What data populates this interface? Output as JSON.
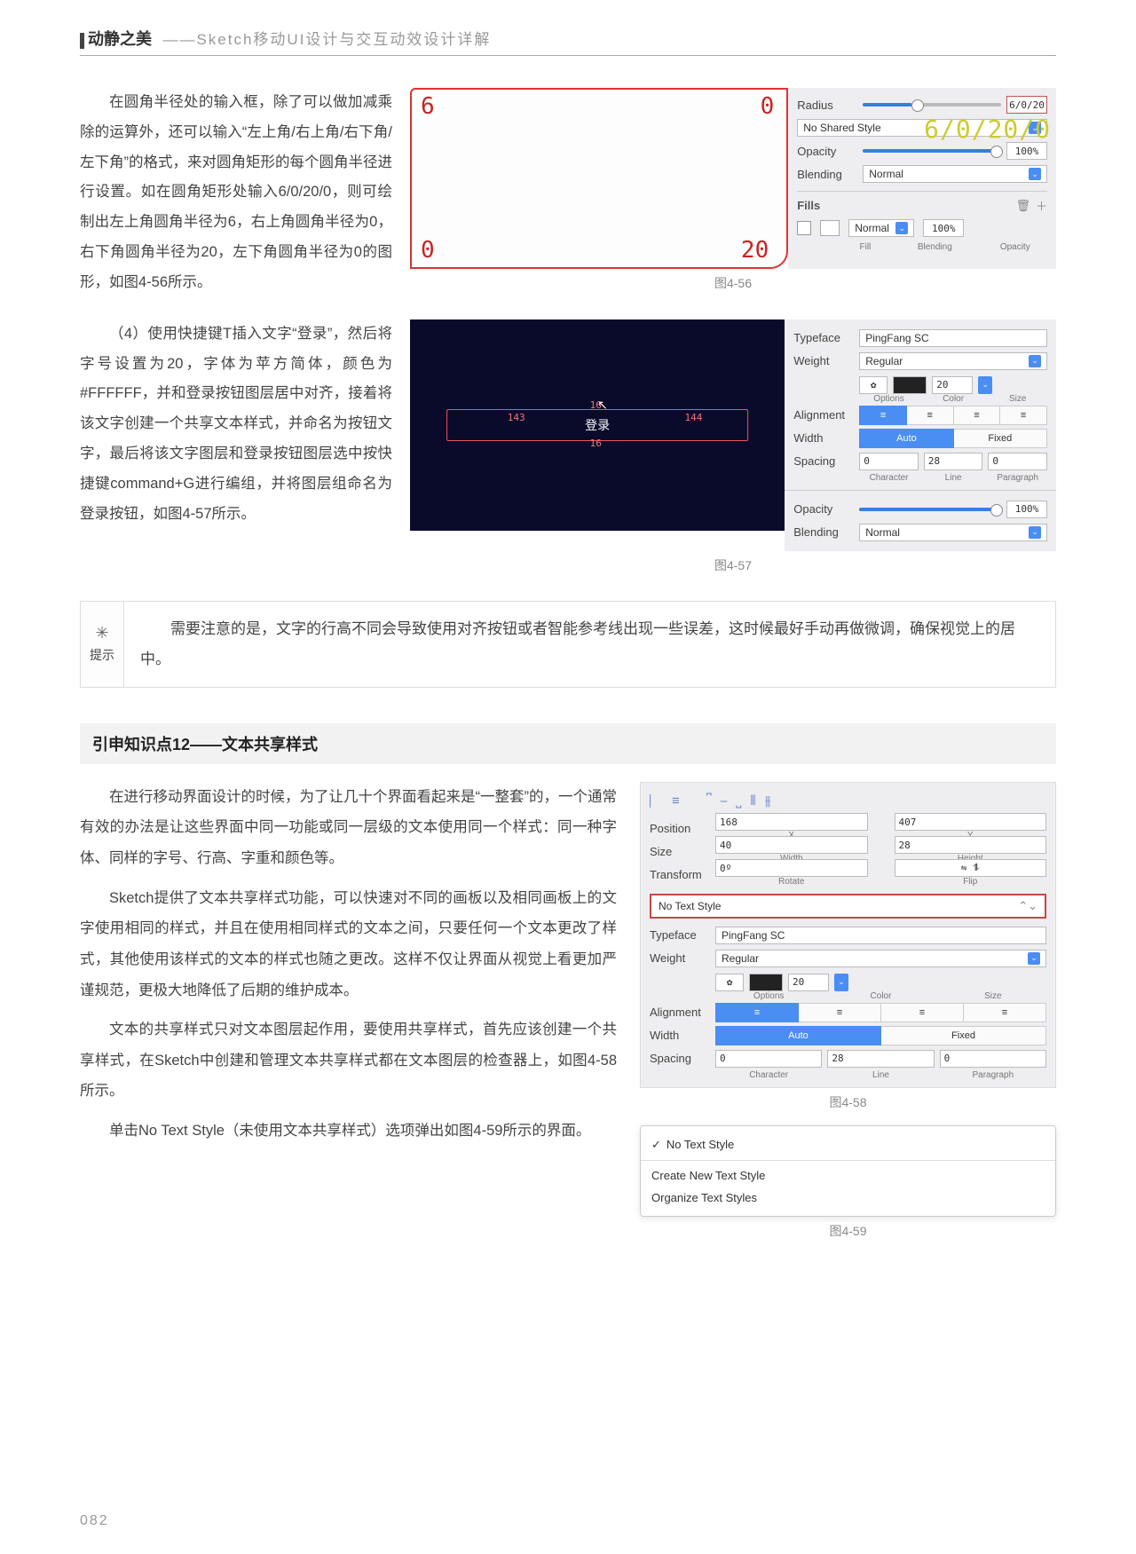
{
  "header": {
    "title": "动静之美",
    "subtitle": "——Sketch移动UI设计与交互动效设计详解"
  },
  "p1": "在圆角半径处的输入框，除了可以做加减乘除的运算外，还可以输入“左上角/右上角/右下角/左下角”的格式，来对圆角矩形的每个圆角半径进行设置。如在圆角矩形处输入6/0/20/0，则可绘制出左上角圆角半径为6，右上角圆角半径为0，右下角圆角半径为20，左下角圆角半径为0的图形，如图4-56所示。",
  "p2": "（4）使用快捷键T插入文字“登录”，然后将字号设置为20，字体为苹方简体，颜色为#FFFFFF，并和登录按钮图层居中对齐，接着将该文字创建一个共享文本样式，并命名为按钮文字，最后将该文字图层和登录按钮图层选中按快捷键command+G进行编组，并将图层组命名为登录按钮，如图4-57所示。",
  "fig56": {
    "caption": "图4-56",
    "corners": {
      "tl": "6",
      "tr": "0",
      "bl": "0",
      "br": "20"
    },
    "radius_label": "Radius",
    "radius_input": "6/0/20",
    "shared_style": "No Shared Style",
    "overlay": "6/0/20/0",
    "opacity_label": "Opacity",
    "opacity_value": "100%",
    "blending_label": "Blending",
    "blending_value": "Normal",
    "fills_label": "Fills",
    "fill_col": "Fill",
    "blend_col": "Blending",
    "opa_col": "Opacity",
    "fill_blend": "Normal",
    "fill_opa": "100%"
  },
  "fig57": {
    "caption": "图4-57",
    "login_text": "登录",
    "m_left": "143",
    "m_right": "144",
    "m_top": "16",
    "m_bottom": "16",
    "typeface_label": "Typeface",
    "typeface_value": "PingFang SC",
    "weight_label": "Weight",
    "weight_value": "Regular",
    "size_value": "20",
    "options_label": "Options",
    "color_label": "Color",
    "size_label": "Size",
    "alignment_label": "Alignment",
    "width_label": "Width",
    "width_auto": "Auto",
    "width_fixed": "Fixed",
    "spacing_label": "Spacing",
    "char_val": "0",
    "line_val": "28",
    "para_val": "0",
    "char_label": "Character",
    "line_label": "Line",
    "para_label": "Paragraph",
    "opacity_label": "Opacity",
    "opacity_value": "100%",
    "blending_label": "Blending",
    "blending_value": "Normal"
  },
  "tip": {
    "side_label": "提示",
    "body": "需要注意的是，文字的行高不同会导致使用对齐按钮或者智能参考线出现一些误差，这时候最好手动再做微调，确保视觉上的居中。"
  },
  "section": {
    "title": "引申知识点12——文本共享样式"
  },
  "p3": "在进行移动界面设计的时候，为了让几十个界面看起来是“一整套”的，一个通常有效的办法是让这些界面中同一功能或同一层级的文本使用同一个样式：同一种字体、同样的字号、行高、字重和颜色等。",
  "p4": "Sketch提供了文本共享样式功能，可以快速对不同的画板以及相同画板上的文字使用相同的样式，并且在使用相同样式的文本之间，只要任何一个文本更改了样式，其他使用该样式的文本的样式也随之更改。这样不仅让界面从视觉上看更加严谨规范，更极大地降低了后期的维护成本。",
  "p5": "文本的共享样式只对文本图层起作用，要使用共享样式，首先应该创建一个共享样式，在Sketch中创建和管理文本共享样式都在文本图层的检查器上，如图4-58所示。",
  "p6": "单击No Text Style（未使用文本共享样式）选项弹出如图4-59所示的界面。",
  "fig58": {
    "caption": "图4-58",
    "position_label": "Position",
    "x": "168",
    "y": "407",
    "xl": "X",
    "yl": "Y",
    "size_label": "Size",
    "w": "40",
    "h": "28",
    "wl": "Width",
    "hl": "Height",
    "transform_label": "Transform",
    "rot": "0º",
    "rl": "Rotate",
    "fl": "Flip",
    "notext": "No Text Style",
    "typeface_label": "Typeface",
    "typeface_value": "PingFang SC",
    "weight_label": "Weight",
    "weight_value": "Regular",
    "size_value": "20",
    "options_label": "Options",
    "color_label": "Color",
    "size_label2": "Size",
    "alignment_label": "Alignment",
    "width_label": "Width",
    "width_auto": "Auto",
    "width_fixed": "Fixed",
    "spacing_label": "Spacing",
    "char_val": "0",
    "line_val": "28",
    "para_val": "0",
    "char_label": "Character",
    "line_label": "Line",
    "para_label": "Paragraph"
  },
  "fig59": {
    "caption": "图4-59",
    "item1": "No Text Style",
    "item2": "Create New Text Style",
    "item3": "Organize Text Styles"
  },
  "page_number": "082"
}
